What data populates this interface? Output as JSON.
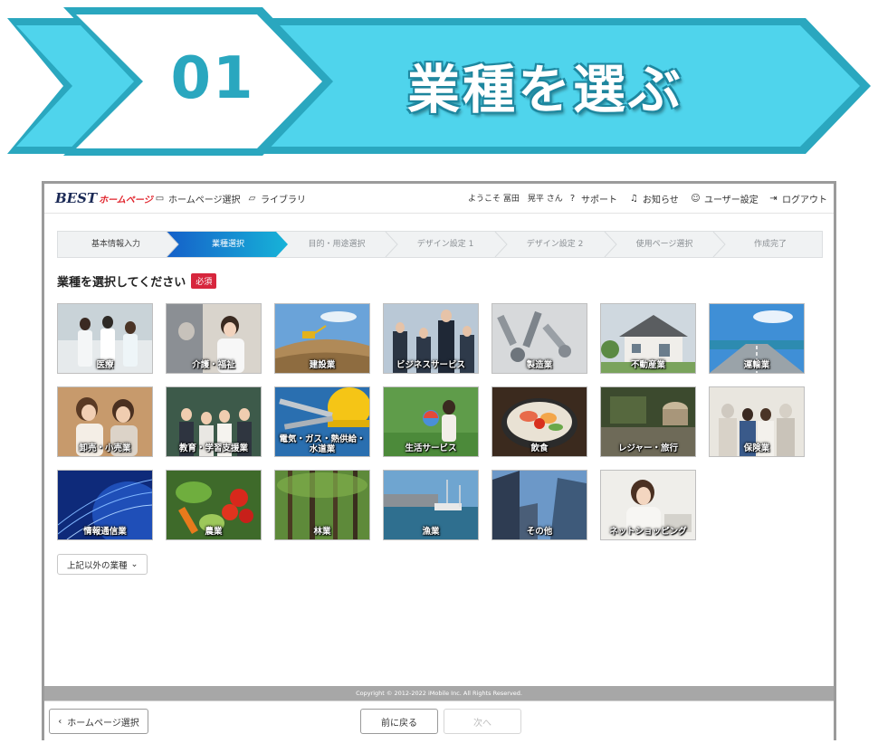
{
  "banner": {
    "step_number": "01",
    "title": "業種を選ぶ"
  },
  "nav": {
    "logo_main": "BEST",
    "logo_sub": "ホームページ",
    "homepage_select": "ホームページ選択",
    "library": "ライブラリ",
    "welcome": "ようこそ 冨田　晃平 さん",
    "support": "サポート",
    "news": "お知らせ",
    "user_settings": "ユーザー設定",
    "logout": "ログアウト"
  },
  "steps": [
    {
      "label": "基本情報入力",
      "state": "done"
    },
    {
      "label": "業種選択",
      "state": "active"
    },
    {
      "label": "目的・用途選択",
      "state": "pending"
    },
    {
      "label": "デザイン設定 1",
      "state": "pending"
    },
    {
      "label": "デザイン設定 2",
      "state": "pending"
    },
    {
      "label": "使用ページ選択",
      "state": "pending"
    },
    {
      "label": "作成完了",
      "state": "pending"
    }
  ],
  "heading": {
    "text": "業種を選択してください",
    "required": "必須"
  },
  "industries": [
    {
      "label": "医療",
      "icon": "medical-photo"
    },
    {
      "label": "介護・福祉",
      "icon": "care-photo"
    },
    {
      "label": "建設業",
      "icon": "construction-photo"
    },
    {
      "label": "ビジネスサービス",
      "icon": "business-photo"
    },
    {
      "label": "製造業",
      "icon": "manufacturing-photo"
    },
    {
      "label": "不動産業",
      "icon": "realestate-photo"
    },
    {
      "label": "運輸業",
      "icon": "transport-photo"
    },
    {
      "label": "卸売・小売業",
      "icon": "retail-photo"
    },
    {
      "label": "教育・学習支援業",
      "icon": "education-photo"
    },
    {
      "label": "電気・ガス・熱供給・水道業",
      "icon": "utilities-photo"
    },
    {
      "label": "生活サービス",
      "icon": "lifeservice-photo"
    },
    {
      "label": "飲食",
      "icon": "food-photo"
    },
    {
      "label": "レジャー・旅行",
      "icon": "leisure-photo"
    },
    {
      "label": "保険業",
      "icon": "insurance-photo"
    },
    {
      "label": "情報通信業",
      "icon": "it-photo"
    },
    {
      "label": "農業",
      "icon": "agriculture-photo"
    },
    {
      "label": "林業",
      "icon": "forestry-photo"
    },
    {
      "label": "漁業",
      "icon": "fishery-photo"
    },
    {
      "label": "その他",
      "icon": "other-photo"
    },
    {
      "label": "ネットショッピング",
      "icon": "eshop-photo"
    }
  ],
  "more_button": "上記以外の業種",
  "copyright": "Copyright © 2012-2022 iMobile Inc. All Rights Reserved.",
  "footer": {
    "back_home": "ホームページ選択",
    "prev": "前に戻る",
    "next": "次へ"
  },
  "colors": {
    "banner": "#4fd4ec",
    "banner_edge": "#2aa7bf",
    "active_step": "#1a86d1",
    "required": "#d7263d"
  }
}
